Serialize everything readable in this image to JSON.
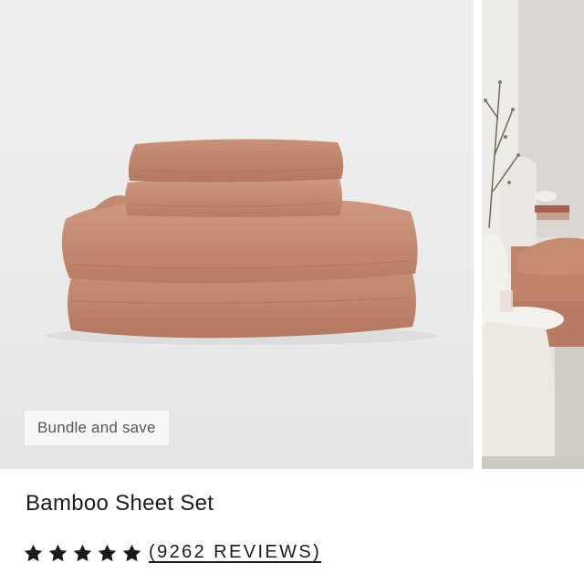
{
  "product": {
    "badge": "Bundle and save",
    "title": "Bamboo Sheet Set",
    "rating": 5,
    "reviews_open": "(",
    "reviews_count": "9262",
    "reviews_word": "REVIEWS",
    "reviews_close": ")"
  },
  "colors": {
    "sheet": "#c58b72",
    "text": "#1a1a1a",
    "badge_bg": "#f8f8f8",
    "image_bg": "#ebebec"
  },
  "icons": {
    "star": "star-icon"
  }
}
